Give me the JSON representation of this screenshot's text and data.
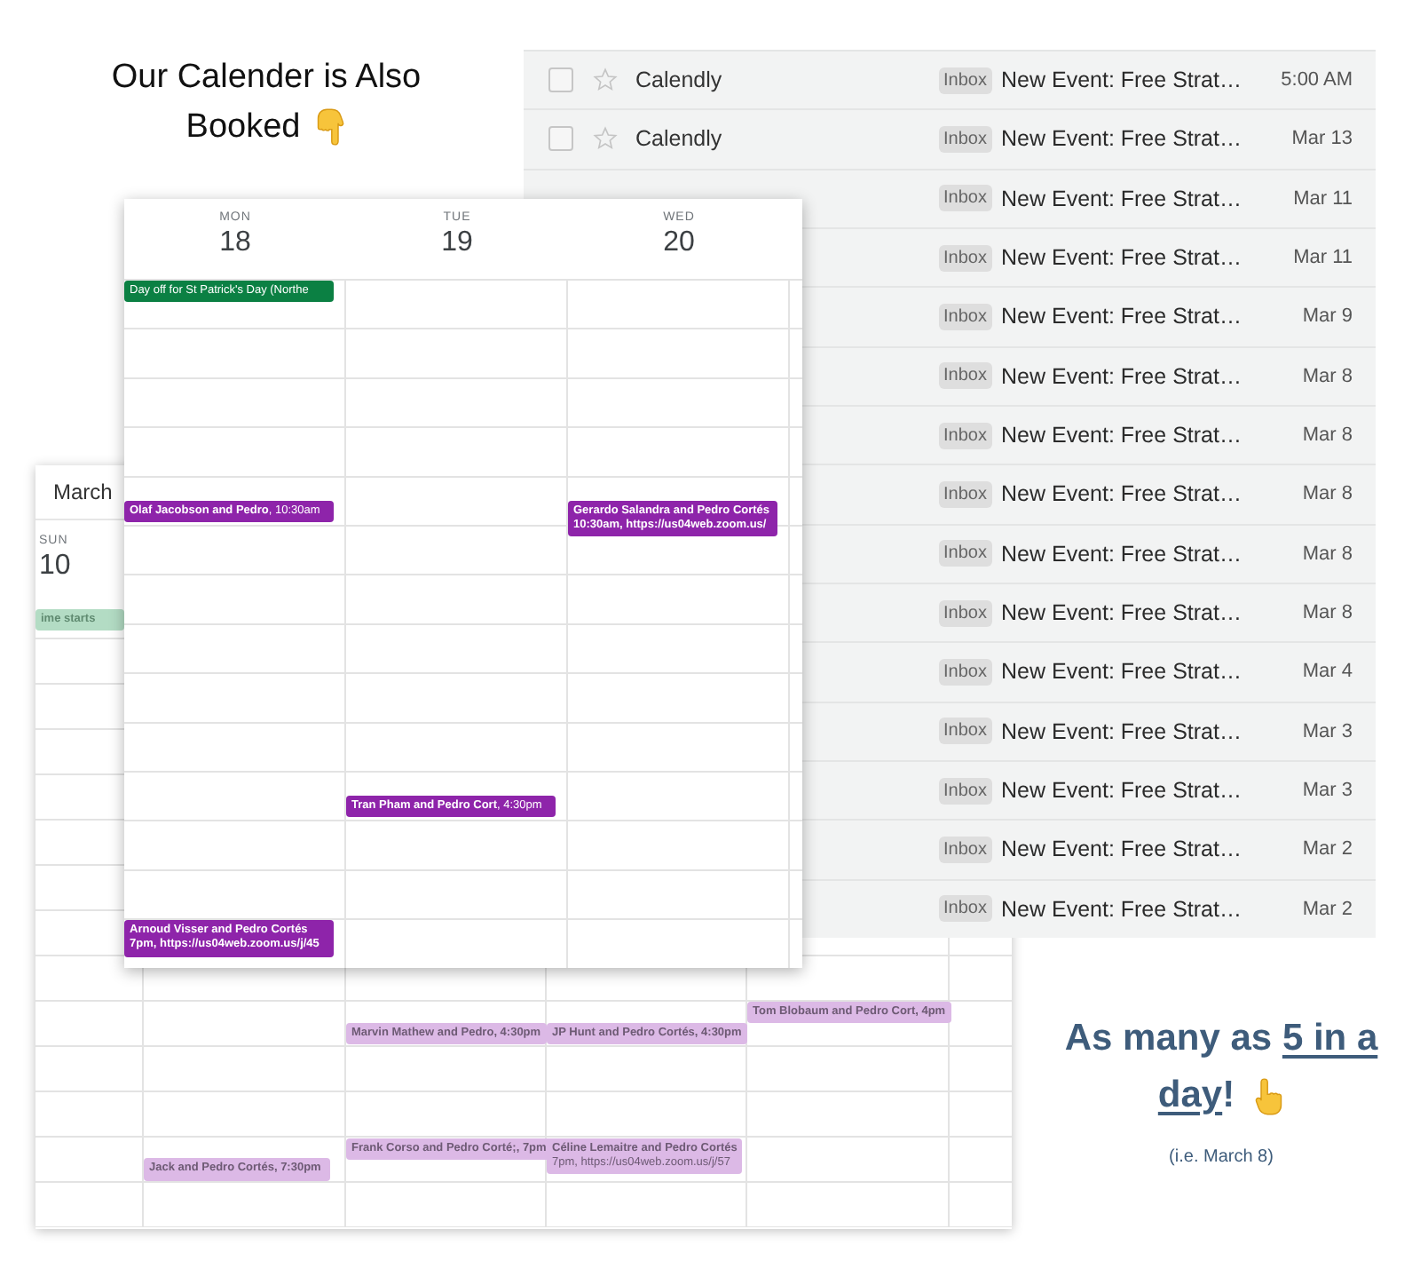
{
  "caption": {
    "lines": [
      "Our Calender is Also",
      "Booked"
    ]
  },
  "inbox": {
    "rows": [
      {
        "checked": false,
        "sender": "Calendly",
        "label": "Inbox",
        "subject": "New Event: Free Strat…",
        "date": "5:00 AM"
      },
      {
        "checked": false,
        "sender": "Calendly",
        "label": "Inbox",
        "subject": "New Event: Free Strat…",
        "date": "Mar 13"
      },
      {
        "label": "Inbox",
        "subject": "New Event: Free Strat…",
        "date": "Mar 11"
      },
      {
        "label": "Inbox",
        "subject": "New Event: Free Strat…",
        "date": "Mar 11"
      },
      {
        "label": "Inbox",
        "subject": "New Event: Free Strat…",
        "date": "Mar 9"
      },
      {
        "label": "Inbox",
        "subject": "New Event: Free Strat…",
        "date": "Mar 8"
      },
      {
        "label": "Inbox",
        "subject": "New Event: Free Strat…",
        "date": "Mar 8"
      },
      {
        "label": "Inbox",
        "subject": "New Event: Free Strat…",
        "date": "Mar 8"
      },
      {
        "label": "Inbox",
        "subject": "New Event: Free Strat…",
        "date": "Mar 8"
      },
      {
        "label": "Inbox",
        "subject": "New Event: Free Strat…",
        "date": "Mar 8"
      },
      {
        "label": "Inbox",
        "subject": "New Event: Free Strat…",
        "date": "Mar 4"
      },
      {
        "label": "Inbox",
        "subject": "New Event: Free Strat…",
        "date": "Mar 3"
      },
      {
        "label": "Inbox",
        "subject": "New Event: Free Strat…",
        "date": "Mar 3"
      },
      {
        "label": "Inbox",
        "subject": "New Event: Free Strat…",
        "date": "Mar 2"
      },
      {
        "label": "Inbox",
        "subject": "New Event: Free Strat…",
        "date": "Mar 2"
      }
    ]
  },
  "back_calendar": {
    "title": "March",
    "weekday": "SUN",
    "date": "10",
    "all_day": {
      "kind": "inline",
      "text": "ime starts",
      "color": "#b3dcc4"
    },
    "rows": [
      [
        null,
        null,
        null,
        null,
        null,
        null
      ],
      [
        null,
        null,
        null,
        null,
        null,
        null
      ],
      [
        null,
        null,
        null,
        null,
        null,
        null
      ],
      [
        null,
        null,
        null,
        null,
        null,
        null
      ],
      [
        null,
        null,
        null,
        null,
        null,
        null
      ],
      [
        null,
        null,
        null,
        null,
        null,
        null
      ],
      [
        null,
        null,
        null,
        null,
        null,
        null
      ],
      [
        null,
        null,
        null,
        null,
        null,
        null
      ],
      [
        null,
        null,
        {
          "kind": "inline",
          "text": "Marvin Mathew and Pedro**, 4:30pm**",
          "half_hour": true,
          "color": "#dcb9e6"
        },
        {
          "kind": "inline",
          "text": "JP Hunt and Pedro Cortés**, 4:30pm**",
          "half_hour": true,
          "color": "#dcb9e6"
        },
        {
          "kind": "inline",
          "text": "Tom Blobaum and Pedro Cort**, 4pm**",
          "half_hour": false,
          "color": "#dcb9e6"
        },
        null
      ],
      [
        null,
        null,
        null,
        null,
        null,
        null
      ],
      [
        null,
        null,
        null,
        null,
        null,
        null
      ],
      [
        null,
        {
          "kind": "inline",
          "text": "Jack and Pedro Cortés**, 7:30pm**",
          "half_hour": true,
          "color": "#dcb9e6"
        },
        {
          "kind": "inline",
          "text": "Frank Corso and Pedro Corté;**, 7pm**",
          "half_hour": false,
          "color": "#dcb9e6"
        },
        {
          "kind": "stacked",
          "title": "Céline Lemaitre and Pedro Cortés",
          "detail": "7pm, https://us04web.zoom.us/j/57",
          "half_hour": false,
          "color": "#dcb9e6"
        },
        null,
        null
      ],
      [
        null,
        null,
        null,
        null,
        null,
        null
      ]
    ]
  },
  "front_calendar": {
    "days": [
      {
        "weekday": "MON",
        "date": "18"
      },
      {
        "weekday": "TUE",
        "date": "19"
      },
      {
        "weekday": "WED",
        "date": "20"
      }
    ],
    "rows": [
      [
        {
          "kind": "inline",
          "text": "Day off for St Patrick's Day (Northe",
          "half_hour": false,
          "color": "#0b8043"
        },
        null,
        null
      ],
      [
        null,
        null,
        null
      ],
      [
        null,
        null,
        null
      ],
      [
        null,
        null,
        null
      ],
      [
        {
          "kind": "inline",
          "text": "**Olaf Jacobson and Pedro**, 10:30am",
          "half_hour": true,
          "color": "#8e24aa"
        },
        null,
        {
          "kind": "stacked",
          "title": "Gerardo Salandra and Pedro Cortés",
          "detail": "10:30am, https://us04web.zoom.us/",
          "half_hour": true,
          "color": "#8e24aa"
        }
      ],
      [
        null,
        null,
        null
      ],
      [
        null,
        null,
        null
      ],
      [
        null,
        null,
        null
      ],
      [
        null,
        null,
        null
      ],
      [
        null,
        null,
        null
      ],
      [
        null,
        {
          "kind": "inline",
          "text": "**Tran Pham and Pedro Cort**, 4:30pm",
          "half_hour": true,
          "color": "#8e24aa"
        },
        null
      ],
      [
        null,
        null,
        null
      ],
      [
        null,
        null,
        null
      ],
      [
        {
          "kind": "stacked",
          "title": "Arnoud Visser and Pedro Cortés",
          "detail": "7pm, https://us04web.zoom.us/j/45",
          "half_hour": false,
          "color": "#8e24aa"
        },
        null,
        null
      ]
    ]
  },
  "highlight": {
    "lines": [
      {
        "plain": "As many as ",
        "underlined": "5 in a"
      },
      {
        "underlined": "day",
        "plain_after": "!"
      }
    ],
    "note": "(i.e. March 8)"
  }
}
